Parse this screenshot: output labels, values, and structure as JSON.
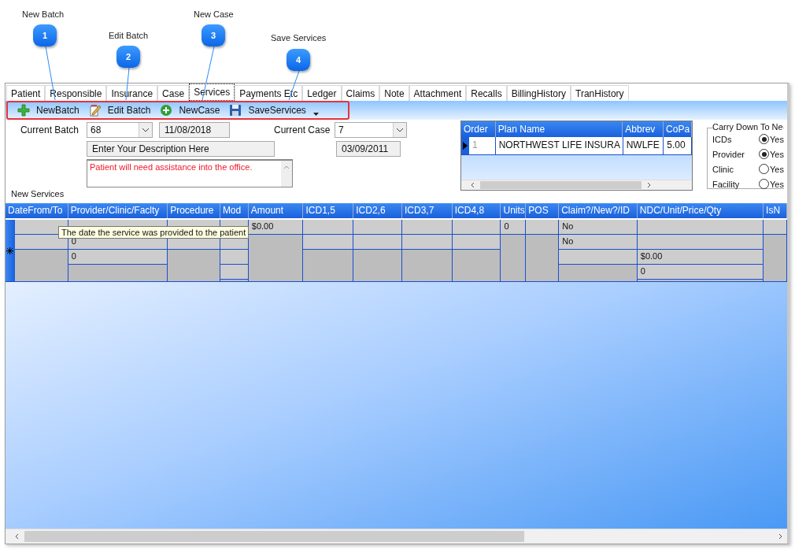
{
  "callouts": [
    {
      "number": "1",
      "label": "New Batch"
    },
    {
      "number": "2",
      "label": "Edit Batch"
    },
    {
      "number": "3",
      "label": "New Case"
    },
    {
      "number": "4",
      "label": "Save Services"
    }
  ],
  "tabs": [
    {
      "label": "Patient",
      "selected": false
    },
    {
      "label": "Responsible",
      "selected": false
    },
    {
      "label": "Insurance",
      "selected": false
    },
    {
      "label": "Case",
      "selected": false
    },
    {
      "label": "Services",
      "selected": true
    },
    {
      "label": "Payments Etc",
      "selected": false
    },
    {
      "label": "Ledger",
      "selected": false
    },
    {
      "label": "Claims",
      "selected": false
    },
    {
      "label": "Note",
      "selected": false
    },
    {
      "label": "Attachment",
      "selected": false
    },
    {
      "label": "Recalls",
      "selected": false
    },
    {
      "label": "BillingHistory",
      "selected": false
    },
    {
      "label": "TranHistory",
      "selected": false
    }
  ],
  "toolbar": {
    "buttons": [
      {
        "label": "NewBatch",
        "kind": "plus"
      },
      {
        "label": "Edit Batch",
        "kind": "edit"
      },
      {
        "label": "NewCase",
        "kind": "addcircle"
      },
      {
        "label": "SaveServices",
        "kind": "save"
      }
    ]
  },
  "batch": {
    "label": "Current Batch",
    "value": "68",
    "date": "11/08/2018",
    "description": "Enter Your Description Here",
    "note": "Patient will need assistance into the office."
  },
  "case": {
    "label": "Current Case",
    "value": "7",
    "date": "03/09/2011"
  },
  "insurance": {
    "columns": [
      "Order",
      "Plan Name",
      "Abbrev",
      "CoPa"
    ],
    "rows": [
      {
        "selected": true,
        "cells": [
          "1",
          "NORTHWEST LIFE INSURA",
          "NWLFE",
          "5.00"
        ]
      }
    ]
  },
  "carry_down": {
    "title": "Carry Down To Ne",
    "options": [
      {
        "label": "ICDs",
        "choice": "Yes",
        "checked": true
      },
      {
        "label": "Provider",
        "choice": "Yes",
        "checked": true
      },
      {
        "label": "Clinic",
        "choice": "Yes",
        "checked": false
      },
      {
        "label": "Facility",
        "choice": "Yes",
        "checked": false
      }
    ]
  },
  "services": {
    "title": "New Services",
    "columns": [
      {
        "label": "DateFrom/To",
        "cells": [
          {},
          {}
        ]
      },
      {
        "label": "Provider/Clinic/Faclty",
        "cells": [
          {},
          {
            "text": "0"
          },
          {
            "text": "0"
          }
        ]
      },
      {
        "label": "Procedure",
        "cells": [
          {},
          {}
        ]
      },
      {
        "label": "Mod",
        "cells": [
          {},
          {},
          {},
          {}
        ]
      },
      {
        "label": "Amount",
        "cells": [
          {
            "text": "$0.00"
          }
        ]
      },
      {
        "label": "ICD1,5",
        "cells": [
          {},
          {}
        ]
      },
      {
        "label": "ICD2,6",
        "cells": [
          {},
          {}
        ]
      },
      {
        "label": "ICD3,7",
        "cells": [
          {},
          {}
        ]
      },
      {
        "label": "ICD4,8",
        "cells": [
          {},
          {}
        ]
      },
      {
        "label": "Units",
        "cells": [
          {
            "text": "0"
          }
        ]
      },
      {
        "label": "POS",
        "cells": [
          {}
        ]
      },
      {
        "label": "Claim?/New?/ID",
        "cells": [
          {
            "text": "No"
          },
          {
            "text": "No"
          },
          {}
        ]
      },
      {
        "label": "NDC/Unit/Price/Qty",
        "cells": [
          {},
          {},
          {
            "text": "$0.00"
          },
          {
            "text": "0"
          }
        ]
      },
      {
        "label": "IsN",
        "cells": [
          {}
        ]
      }
    ]
  },
  "tooltip": "The date the service was provided to the patient"
}
